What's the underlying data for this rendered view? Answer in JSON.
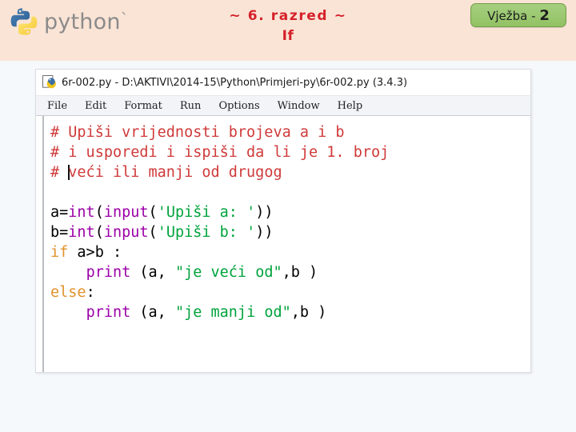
{
  "slide": {
    "logo_wordmark": "python",
    "logo_tick": "`",
    "title_line1": "~ 6. razred ~",
    "title_line2": "If",
    "badge_label": "Vježba - ",
    "badge_number": "2",
    "colors": {
      "header_bg": "#fae4d6",
      "title_red": "#d6212a",
      "badge_green": "#92c264",
      "body_bg": "#f6f9fc"
    }
  },
  "idle": {
    "window_title": "6r-002.py - D:\\AKTIVI\\2014-15\\Python\\Primjeri-py\\6r-002.py (3.4.3)",
    "icon": "python-idle-icon",
    "menu": [
      {
        "label": "File"
      },
      {
        "label": "Edit"
      },
      {
        "label": "Format"
      },
      {
        "label": "Run"
      },
      {
        "label": "Options"
      },
      {
        "label": "Window"
      },
      {
        "label": "Help"
      }
    ],
    "code": {
      "comment1": "# Upiši vrijednosti brojeva a i b",
      "comment2": "# i usporedi i ispiši da li je 1. broj",
      "comment3_hash": "# ",
      "comment3_rest": "veći ili manji od drugog",
      "line_a_var": "a=",
      "line_a_int": "int",
      "line_a_paren": "(",
      "line_a_input": "input",
      "line_a_paren2": "(",
      "line_a_str": "'Upiši a: '",
      "line_a_close": "))",
      "line_b_var": "b=",
      "line_b_int": "int",
      "line_b_paren": "(",
      "line_b_input": "input",
      "line_b_paren2": "(",
      "line_b_str": "'Upiši b: '",
      "line_b_close": "))",
      "if_kw": "if",
      "if_cond": " a>b :",
      "print1_indent": "    ",
      "print1_kw": "print",
      "print1_a": " (a, ",
      "print1_str": "\"je veći od\"",
      "print1_b": ",b )",
      "else_kw": "else",
      "else_colon": ":",
      "print2_indent": "    ",
      "print2_kw": "print",
      "print2_a": " (a, ",
      "print2_str": "\"je manji od\"",
      "print2_b": ",b )"
    }
  }
}
